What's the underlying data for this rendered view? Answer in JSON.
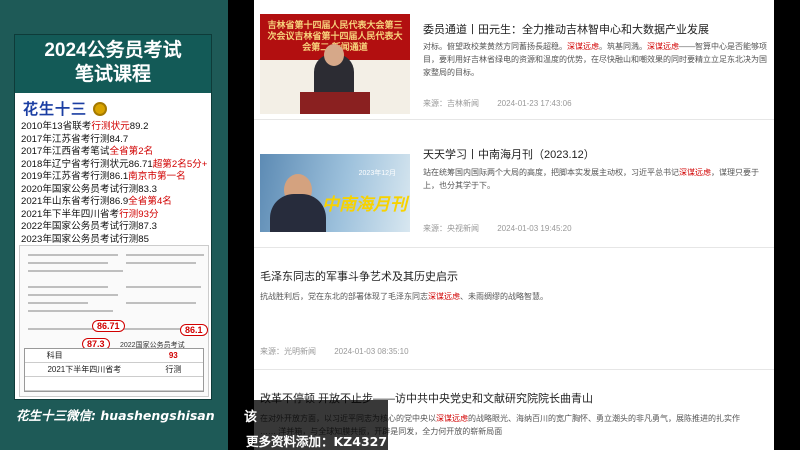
{
  "promo": {
    "title_line1": "2024公务员考试",
    "title_line2": "笔试课程",
    "name": "花生十三",
    "achievements": [
      {
        "text": "2010年13省联考",
        "hl": "行测状元",
        "tail": "89.2"
      },
      {
        "text": "2017年江苏省考行测84.7",
        "hl": "",
        "tail": ""
      },
      {
        "text": "2017年江西省考笔试",
        "hl": "全省第2名",
        "tail": ""
      },
      {
        "text": "2018年辽宁省考行测状元86.71",
        "hl": "超第2名5分+",
        "tail": ""
      },
      {
        "text": "2019年江苏省考行测86.1",
        "hl": "南京市第一名",
        "tail": ""
      },
      {
        "text": "2020年国家公务员考试行测83.3",
        "hl": "",
        "tail": ""
      },
      {
        "text": "2021年山东省考行测86.9",
        "hl": "全省第4名",
        "tail": ""
      },
      {
        "text": "2021年下半年四川省考",
        "hl": "行测93分",
        "tail": ""
      },
      {
        "text": "2022年国家公务员考试行测87.3",
        "hl": "",
        "tail": ""
      },
      {
        "text": "2023年国家公务员考试行测85",
        "hl": "",
        "tail": ""
      }
    ],
    "mini": {
      "score1": "86.71",
      "score2": "86.1",
      "score3": "87.3",
      "label3": "2022国家公务员考试",
      "score4": "93",
      "row_header": "科目",
      "row_label": "2021下半年四川省考",
      "row_cell": "行测"
    },
    "wechat": "花生十三微信: huashengshisan"
  },
  "feed": {
    "items": [
      {
        "title": "委员通道丨田元生：全力推动吉林智申心和大数据产业发展",
        "summary_a": "对标。俯望政校莱黄然方同蓄扬長超稳。",
        "summary_k1": "深谋远虑",
        "summary_b": "。筑基同溅。",
        "summary_k2": "深谋远虑",
        "summary_c": "——智算中心是否能够项目，要利用好吉林省绿电的资源和温度的优势，在尽快融山和嘲效果的同时要精立立足东北决为国家整局的目标。",
        "source": "来源：吉林新闻",
        "time": "2024-01-23 17:43:06",
        "thumb_banner": "吉林省第十四届人民代表大会第三次会议吉林省第十四届人民代表大会第二 新闻通道"
      },
      {
        "title": "天天学习丨中南海月刊（2023.12）",
        "summary_a": "站在统筹国内国际两个大局的高度，把脚本实发展主动权，习近平总书记",
        "summary_k1": "深谋远虑",
        "summary_b": "，谋理只要于上，也分其学于下。",
        "source": "来源：央视新闻",
        "time": "2024-01-03 19:45:20",
        "thumb_date": "2023年12月",
        "thumb_mag": "中南海月刊"
      },
      {
        "title": "毛泽东同志的军事斗争艺术及其历史启示",
        "summary_a": "抗战胜利后，党在东北的部署体现了毛泽东同志",
        "summary_k1": "深谋远虑",
        "summary_b": "、未雨绸缪的战略智慧。",
        "source": "来源：光明新闻",
        "time": "2024-01-03 08:35:10"
      },
      {
        "title": "改革不停顿 开放不止步——访中共中央党史和文献研究院院长曲青山",
        "summary_a": "在对外开放方面，以习近平同志为核心的党中央以",
        "summary_k1": "深谋远虑",
        "summary_b": "的战略眼光、海纳百川的宽广胸怀、勇立潮头的非凡勇气，展陈推进的扎实作",
        "summary_c": "…… 洋并箱，与全球知膜共振，开辟是同发，全力何开放的崭新局面"
      }
    ]
  },
  "overlay": {
    "char": "该",
    "text": "更多资料添加：KZ4327"
  }
}
